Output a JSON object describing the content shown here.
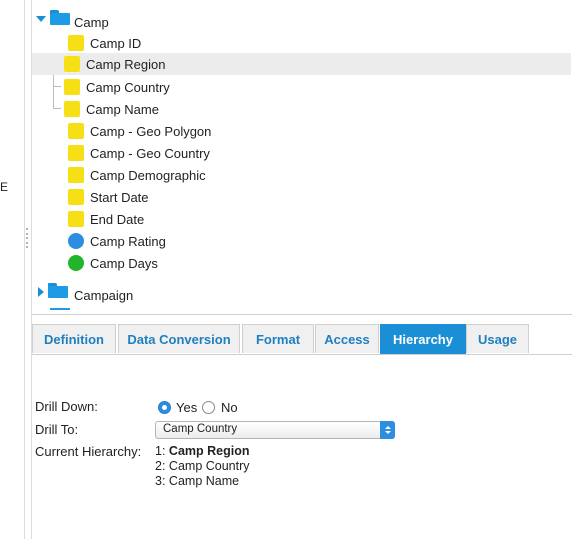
{
  "left_panel": {
    "edge_text": "E"
  },
  "tree": {
    "root": {
      "label": "Camp",
      "expanded": true
    },
    "items": [
      {
        "label": "Camp ID",
        "icon": "yellow-square-icon"
      },
      {
        "label": "Camp Region",
        "icon": "yellow-square-icon",
        "selected": true
      },
      {
        "label": "Camp Country",
        "icon": "yellow-square-icon"
      },
      {
        "label": "Camp Name",
        "icon": "yellow-square-icon"
      },
      {
        "label": "Camp - Geo Polygon",
        "icon": "yellow-square-icon"
      },
      {
        "label": "Camp - Geo Country",
        "icon": "yellow-square-icon"
      },
      {
        "label": "Camp Demographic",
        "icon": "yellow-square-icon"
      },
      {
        "label": "Start Date",
        "icon": "yellow-square-icon"
      },
      {
        "label": "End Date",
        "icon": "yellow-square-icon"
      },
      {
        "label": "Camp Rating",
        "icon": "blue-circle-icon",
        "color": "#2d8ee0"
      },
      {
        "label": "Camp Days",
        "icon": "green-circle-icon",
        "color": "#22b52a"
      }
    ],
    "next_folder": {
      "label": "Campaign",
      "expanded": false
    },
    "colors": {
      "folder": "#1e9be6",
      "attribute": "#f7df16"
    }
  },
  "tabs": [
    {
      "label": "Definition",
      "active": false
    },
    {
      "label": "Data Conversion",
      "active": false
    },
    {
      "label": "Format",
      "active": false
    },
    {
      "label": "Access",
      "active": false
    },
    {
      "label": "Hierarchy",
      "active": true
    },
    {
      "label": "Usage",
      "active": false
    }
  ],
  "form": {
    "drill_down": {
      "label": "Drill Down:",
      "yes": "Yes",
      "no": "No",
      "value": "Yes"
    },
    "drill_to": {
      "label": "Drill To:",
      "value": "Camp Country"
    },
    "current_hierarchy": {
      "label": "Current Hierarchy:",
      "levels": [
        {
          "num": "1:",
          "name": "Camp Region",
          "current": true
        },
        {
          "num": "2:",
          "name": "Camp Country",
          "current": false
        },
        {
          "num": "3:",
          "name": "Camp Name",
          "current": false
        }
      ]
    }
  },
  "accent_color": "#1a8fd6"
}
